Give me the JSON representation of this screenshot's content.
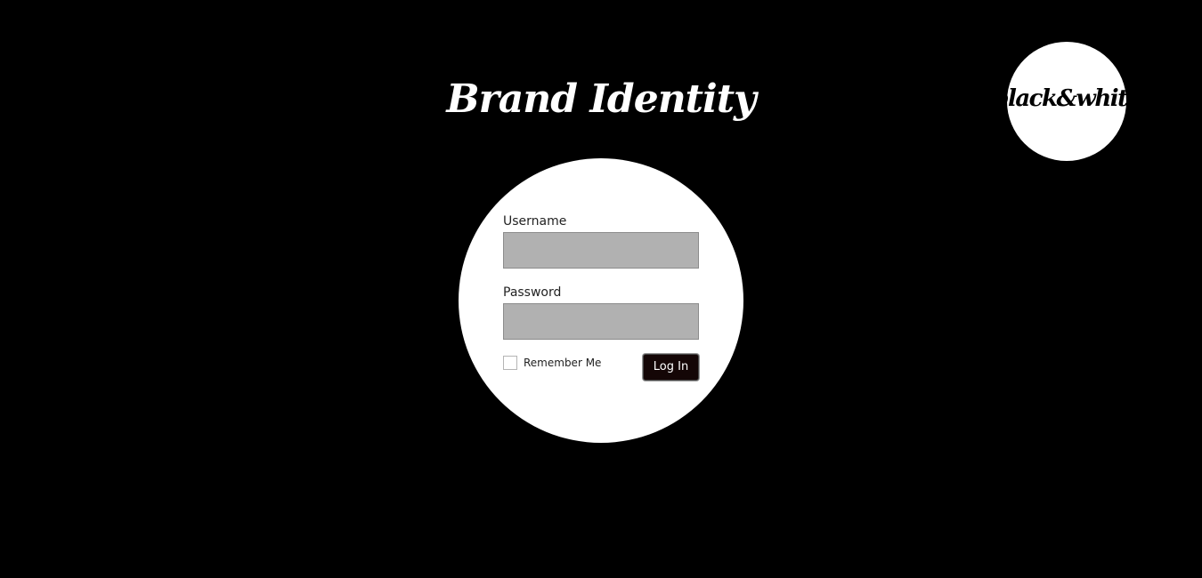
{
  "header": {
    "title": "Brand Identity"
  },
  "logo": {
    "text": "black&white"
  },
  "login_form": {
    "username": {
      "label": "Username",
      "value": ""
    },
    "password": {
      "label": "Password",
      "value": ""
    },
    "remember_me": {
      "label": "Remember Me",
      "checked": false
    },
    "submit_label": "Log In"
  },
  "colors": {
    "background": "#000000",
    "foreground": "#ffffff",
    "input_fill": "#b1b1b1",
    "button_fill": "#140606"
  }
}
